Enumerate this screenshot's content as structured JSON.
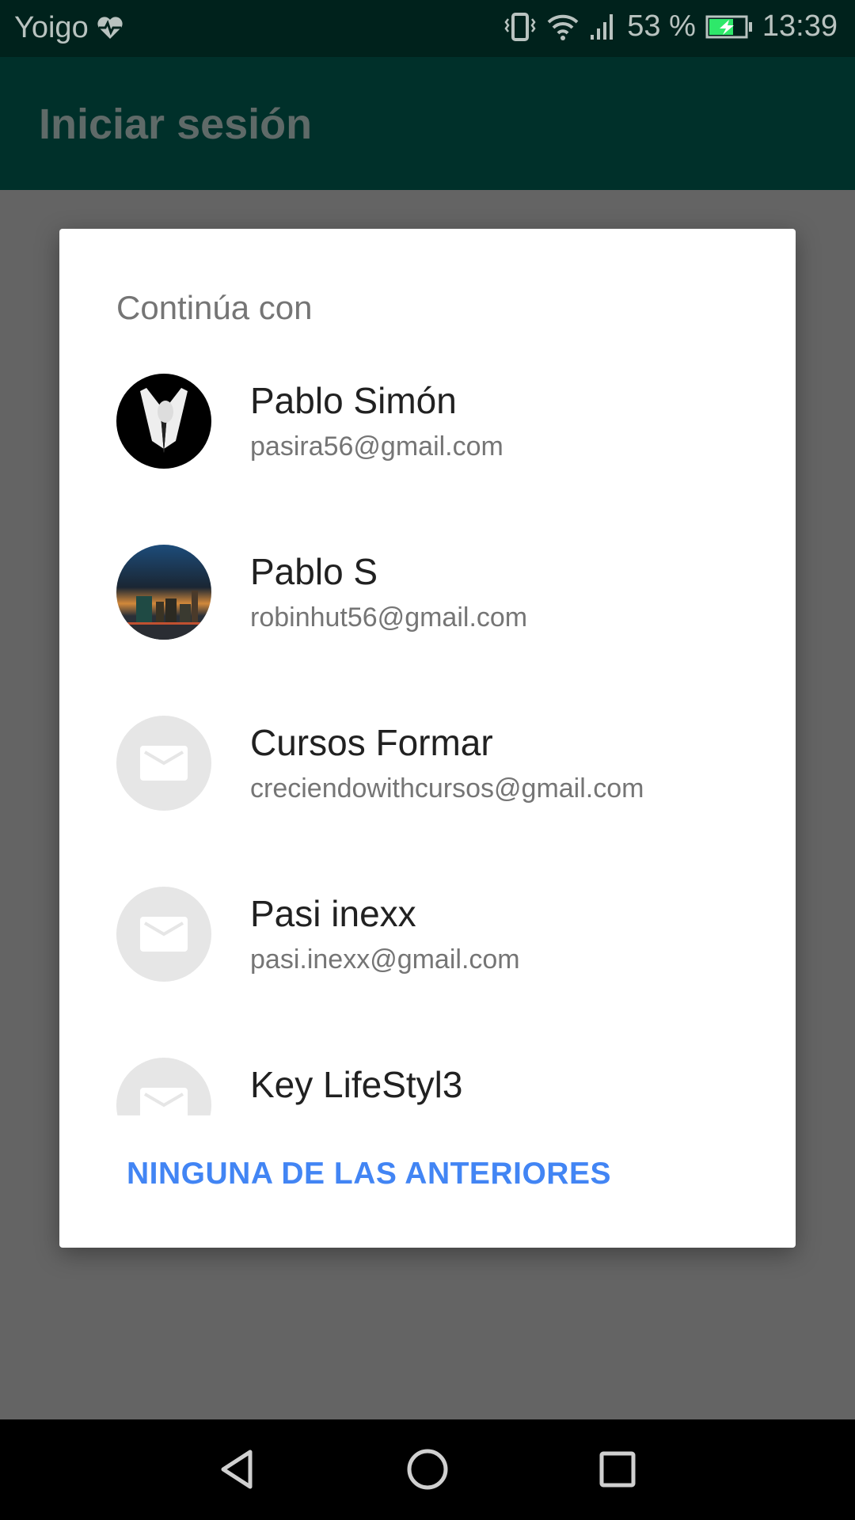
{
  "status_bar": {
    "carrier": "Yoigo",
    "battery": "53 %",
    "time": "13:39",
    "icons": [
      "heart-rate-icon",
      "vibrate-icon",
      "wifi-icon",
      "signal-icon",
      "battery-charging-icon"
    ],
    "battery_color": "#2ee86a"
  },
  "app_bar": {
    "title": "Iniciar sesión",
    "color": "#00302a"
  },
  "dialog": {
    "heading": "Continúa con",
    "accounts": [
      {
        "name": "Pablo Simón",
        "email": "pasira56@gmail.com",
        "avatar": "suit-photo"
      },
      {
        "name": "Pablo S",
        "email": "robinhut56@gmail.com",
        "avatar": "city-skyline-photo"
      },
      {
        "name": "Cursos Formar",
        "email": "creciendowithcursos@gmail.com",
        "avatar": "mail-icon"
      },
      {
        "name": "Pasi inexx",
        "email": "pasi.inexx@gmail.com",
        "avatar": "mail-icon"
      },
      {
        "name": "Key LifeStyl3",
        "email": "",
        "avatar": "mail-icon"
      }
    ],
    "none_button": "NINGUNA DE LAS ANTERIORES",
    "accent": "#4285f4"
  },
  "nav_bar": {
    "icons": [
      "back-icon",
      "home-icon",
      "recents-icon"
    ]
  }
}
